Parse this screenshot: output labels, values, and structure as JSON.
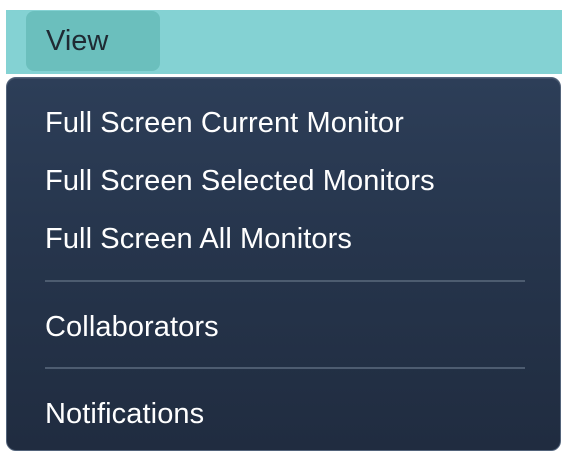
{
  "menubar": {
    "items": [
      {
        "label": "View",
        "active": true
      }
    ]
  },
  "dropdown": {
    "items": [
      {
        "label": "Full Screen Current Monitor"
      },
      {
        "label": "Full Screen Selected Monitors"
      },
      {
        "label": "Full Screen All Monitors"
      },
      {
        "label": "Collaborators"
      },
      {
        "label": "Notifications"
      }
    ]
  },
  "colors": {
    "menubar_background": "#84d2d3",
    "menubar_active_item": "#6bbfbd",
    "dropdown_background": "#26354c",
    "separator": "#4d5c70",
    "menu_text": "#ffffff"
  }
}
